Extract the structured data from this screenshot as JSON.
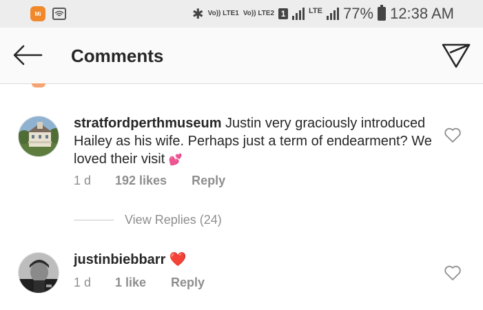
{
  "status_bar": {
    "mi_label": "Mi",
    "volte_1": "Vo)) LTE1",
    "volte_2": "Vo)) LTE2",
    "sim": "1",
    "network": "LTE",
    "battery": "77%",
    "time": "12:38 AM"
  },
  "header": {
    "title": "Comments",
    "back_icon": "arrow-left-icon",
    "send_icon": "paper-plane-icon"
  },
  "comments": [
    {
      "username": "stratfordperthmuseum",
      "text": "Justin very graciously introduced Hailey as his wife. Perhaps just a term of endearment? We loved their visit",
      "emoji": "💕",
      "time": "1 d",
      "likes": "192 likes",
      "reply": "Reply",
      "view_replies": "View Replies (24)"
    },
    {
      "username": "justinbiebbarr",
      "text": "",
      "emoji": "❤️",
      "time": "1 d",
      "likes": "1 like",
      "reply": "Reply"
    }
  ],
  "colors": {
    "text": "#262626",
    "meta": "#8e8e8e",
    "heart_emoji": "#e0245e",
    "status_bg": "#ededed"
  }
}
